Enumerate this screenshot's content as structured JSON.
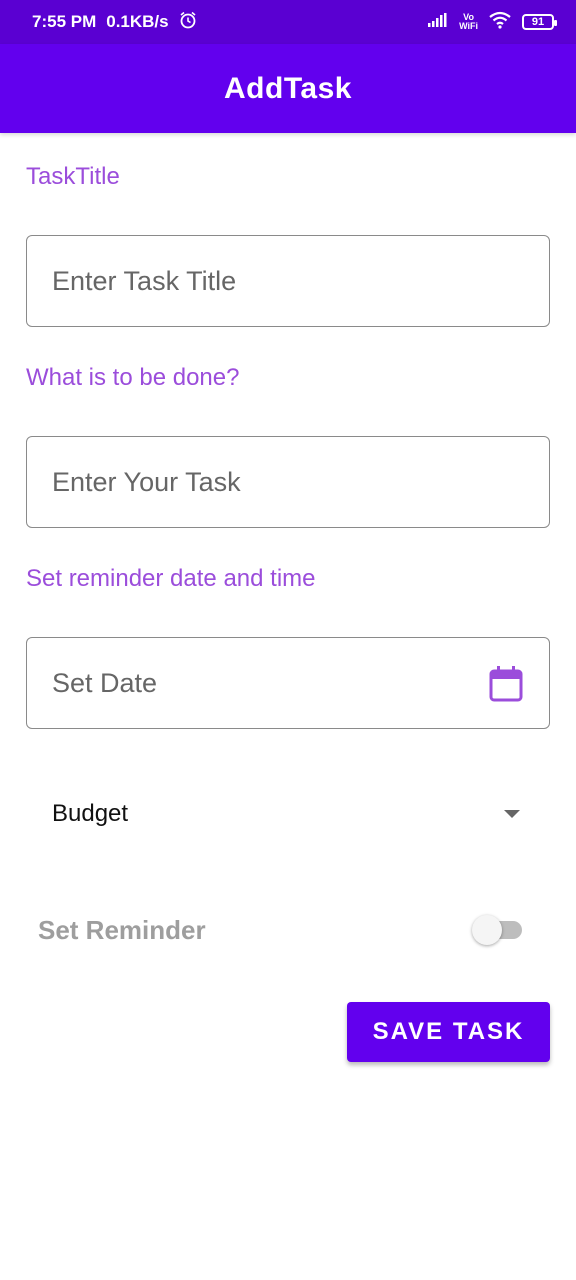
{
  "status_bar": {
    "time": "7:55 PM",
    "data_speed": "0.1KB/s",
    "alarm_icon": "alarm-clock-icon",
    "signal_icon": "signal-bars-icon",
    "vowifi_line1": "Vo",
    "vowifi_line2": "WiFi",
    "wifi_icon": "wifi-icon",
    "battery": "91"
  },
  "app_bar": {
    "title": "AddTask"
  },
  "form": {
    "task_title_label": "TaskTitle",
    "task_title_placeholder": "Enter Task Title",
    "task_label": "What is to be done?",
    "task_placeholder": "Enter Your Task",
    "reminder_label": "Set reminder date and time",
    "date_placeholder": "Set Date",
    "date_icon": "calendar-icon",
    "category_selected": "Budget",
    "set_reminder_label": "Set Reminder",
    "set_reminder_on": false,
    "save_label": "SAVE TASK"
  },
  "colors": {
    "status_bar": "#5A00D2",
    "primary": "#6200EE",
    "label_purple": "#9B4DDB"
  }
}
